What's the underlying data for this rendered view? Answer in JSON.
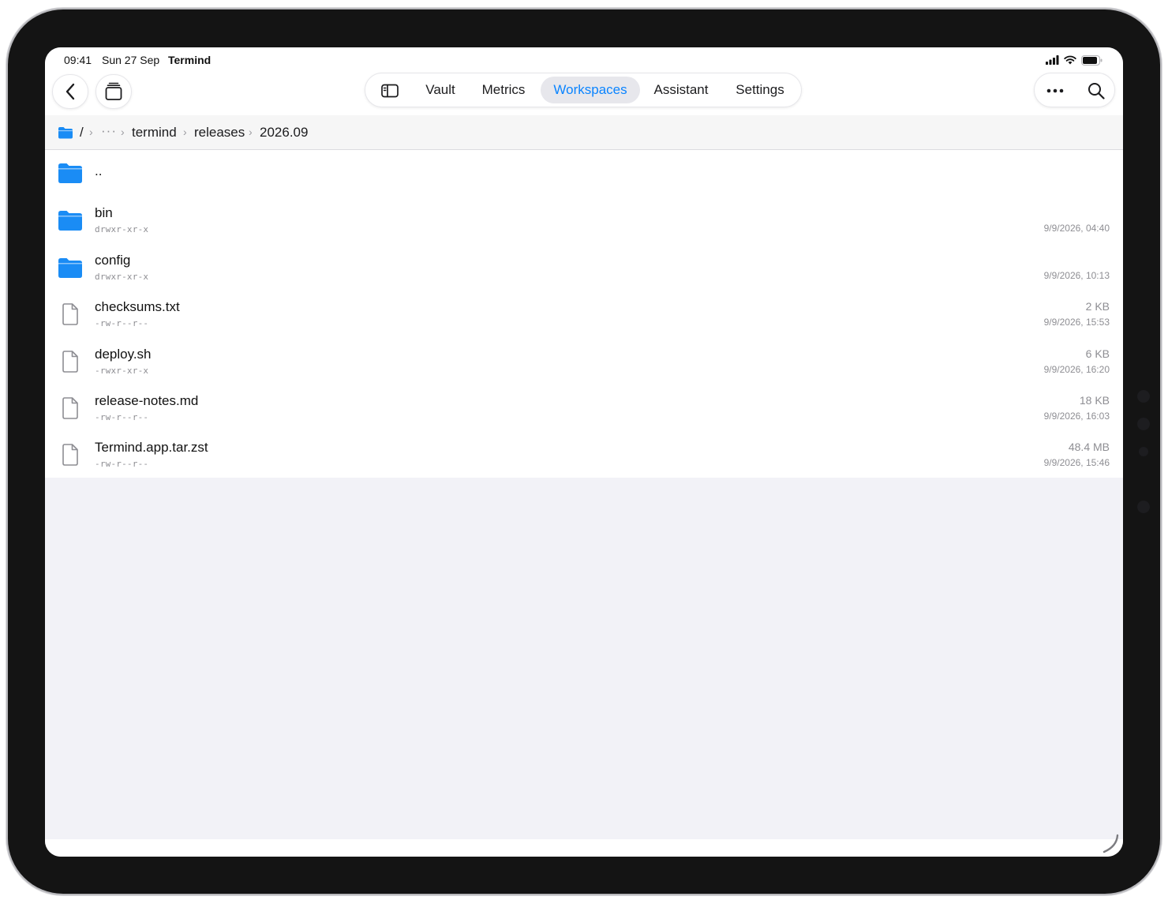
{
  "status_bar": {
    "time": "09:41",
    "date": "Sun 27 Sep",
    "app_name": "Termind"
  },
  "toolbar": {
    "back_icon": "chevron-left-icon",
    "windows_icon": "stacked-windows-icon",
    "sidebar_icon": "sidebar-icon",
    "tabs": [
      {
        "label": "Vault",
        "active": false
      },
      {
        "label": "Metrics",
        "active": false
      },
      {
        "label": "Workspaces",
        "active": true
      },
      {
        "label": "Assistant",
        "active": false
      },
      {
        "label": "Settings",
        "active": false
      }
    ],
    "more_icon": "ellipsis-icon",
    "search_icon": "search-icon"
  },
  "breadcrumb": {
    "root": "/",
    "ellipsis": "···",
    "items": [
      "termind",
      "releases",
      "2026.09"
    ]
  },
  "files": [
    {
      "name": "..",
      "type": "folder",
      "permissions": "",
      "size": "",
      "modified": ""
    },
    {
      "name": "bin",
      "type": "folder",
      "permissions": "drwxr-xr-x",
      "size": "",
      "modified": "9/9/2026, 04:40"
    },
    {
      "name": "config",
      "type": "folder",
      "permissions": "drwxr-xr-x",
      "size": "",
      "modified": "9/9/2026, 10:13"
    },
    {
      "name": "checksums.txt",
      "type": "file",
      "permissions": "-rw-r--r--",
      "size": "2 KB",
      "modified": "9/9/2026, 15:53"
    },
    {
      "name": "deploy.sh",
      "type": "file",
      "permissions": "-rwxr-xr-x",
      "size": "6 KB",
      "modified": "9/9/2026, 16:20"
    },
    {
      "name": "release-notes.md",
      "type": "file",
      "permissions": "-rw-r--r--",
      "size": "18 KB",
      "modified": "9/9/2026, 16:03"
    },
    {
      "name": "Termind.app.tar.zst",
      "type": "file",
      "permissions": "-rw-r--r--",
      "size": "48.4 MB",
      "modified": "9/9/2026, 15:46"
    }
  ],
  "colors": {
    "accent": "#0a84ff",
    "folder": "#1a8cf5",
    "background": "#f2f2f7"
  }
}
